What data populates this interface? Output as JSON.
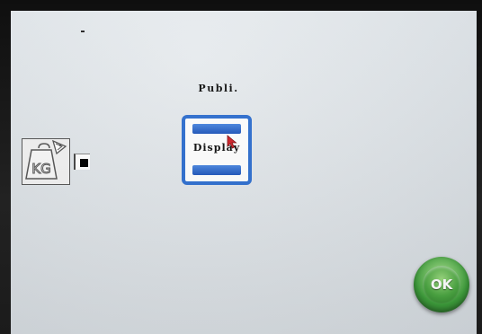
{
  "screen": {
    "title": "Publi.",
    "dash": "-"
  },
  "display_tile": {
    "label": "Display",
    "icon": "display-menu-icon",
    "accent": "#2f6fd0"
  },
  "kg_icon": {
    "label": "KG",
    "icon": "weight-kg-icon"
  },
  "checkbox": {
    "checked": true
  },
  "ok_button": {
    "label": "OK",
    "color": "#3c9c3a"
  }
}
